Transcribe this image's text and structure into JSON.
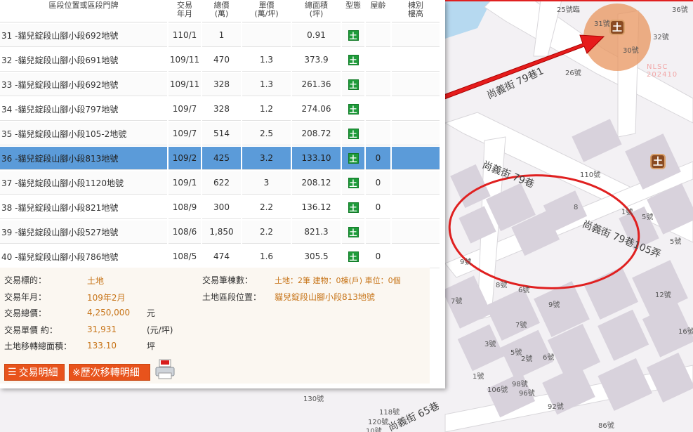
{
  "table": {
    "headers": {
      "location": "區段位置或區段門牌",
      "date": "交易\n年月",
      "total": "總價\n(萬)",
      "unit": "單價\n(萬/坪)",
      "area": "總面積\n(坪)",
      "type": "型態",
      "age": "屋齡",
      "special": "棟別\n樓高"
    },
    "rows": [
      {
        "loc": "31 -貓兒錠段山腳小段692地號",
        "date": "110/1",
        "total": "1",
        "unit": "",
        "area": "0.91",
        "type": "土",
        "age": ""
      },
      {
        "loc": "32 -貓兒錠段山腳小段691地號",
        "date": "109/11",
        "total": "470",
        "unit": "1.3",
        "area": "373.9",
        "type": "土",
        "age": ""
      },
      {
        "loc": "33 -貓兒錠段山腳小段692地號",
        "date": "109/11",
        "total": "328",
        "unit": "1.3",
        "area": "261.36",
        "type": "土",
        "age": ""
      },
      {
        "loc": "34 -貓兒錠段山腳小段797地號",
        "date": "109/7",
        "total": "328",
        "unit": "1.2",
        "area": "274.06",
        "type": "土",
        "age": ""
      },
      {
        "loc": "35 -貓兒錠段山腳小段105-2地號",
        "date": "109/7",
        "total": "514",
        "unit": "2.5",
        "area": "208.72",
        "type": "土",
        "age": ""
      },
      {
        "loc": "36 -貓兒錠段山腳小段813地號",
        "date": "109/2",
        "total": "425",
        "unit": "3.2",
        "area": "133.10",
        "type": "土",
        "age": "0"
      },
      {
        "loc": "37 -貓兒錠段山腳小段1120地號",
        "date": "109/1",
        "total": "622",
        "unit": "3",
        "area": "208.12",
        "type": "土",
        "age": "0"
      },
      {
        "loc": "38 -貓兒錠段山腳小段821地號",
        "date": "108/9",
        "total": "300",
        "unit": "2.2",
        "area": "136.12",
        "type": "土",
        "age": "0"
      },
      {
        "loc": "39 -貓兒錠段山腳小段527地號",
        "date": "108/6",
        "total": "1,850",
        "unit": "2.2",
        "area": "821.3",
        "type": "土",
        "age": ""
      },
      {
        "loc": "40 -貓兒錠段山腳小段786地號",
        "date": "108/5",
        "total": "474",
        "unit": "1.6",
        "area": "305.5",
        "type": "土",
        "age": "0"
      }
    ],
    "selected_index": 5
  },
  "detail": {
    "target_label": "交易標的：",
    "target_value": "土地",
    "date_label": "交易年月：",
    "date_value": "109年2月",
    "total_label": "交易總價：",
    "total_value": "4,250,000",
    "total_unit": "元",
    "unit_label": "交易單價 約：",
    "unit_value": "31,931",
    "unit_unit": "(元/坪)",
    "area_label": "土地移轉總面積：",
    "area_value": "133.10",
    "area_unit": "坪",
    "count_label": "交易筆棟數：",
    "count_value": "土地：2筆 建物：0棟(戶) 車位：0個",
    "land_loc_label": "土地區段位置：",
    "land_loc_value": "貓兒錠段山腳小段813地號"
  },
  "buttons": {
    "detail_btn": "交易明細",
    "history_btn": "※歷次移轉明細",
    "pdf_label": "PDF"
  },
  "map": {
    "streets": [
      "尚義街 79巷1",
      "尚義街 79巷",
      "尚義街 79巷105弄",
      "尚義街 65巷"
    ],
    "watermark": "NLSC 202410",
    "labels": [
      "25號臨",
      "36號",
      "31號",
      "32號",
      "30號",
      "26號",
      "110號",
      "1號",
      "5號",
      "5號",
      "8",
      "9號",
      "8號",
      "6號",
      "12號",
      "7號",
      "9號",
      "7號",
      "16號",
      "3號",
      "5號",
      "2號",
      "6號",
      "1號",
      "98號",
      "106號",
      "96號",
      "92號",
      "130號",
      "118號",
      "120號",
      "86號",
      "10號"
    ],
    "marker_text": "土"
  },
  "colors": {
    "accent": "#e8531c",
    "selected_row": "#5b9bd9",
    "value_text": "#c77418",
    "land_icon": "#1e9b3a"
  }
}
